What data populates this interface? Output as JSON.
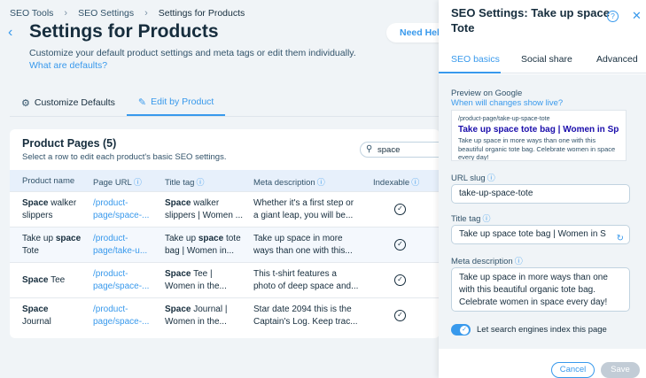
{
  "breadcrumb": [
    "SEO Tools",
    "SEO Settings",
    "Settings for Products"
  ],
  "page": {
    "title": "Settings for Products",
    "subtitle": "Customize your default product settings and meta tags or edit them individually.",
    "defaults_link": "What are defaults?",
    "help_button": "Need Help"
  },
  "tabs": [
    {
      "label": "Customize Defaults",
      "icon": "gear-icon"
    },
    {
      "label": "Edit by Product",
      "icon": "pencil-icon"
    }
  ],
  "table": {
    "title": "Product Pages (5)",
    "subtitle": "Select a row to edit each product's basic SEO settings.",
    "search_value": "space",
    "columns": [
      "Product name",
      "Page URL",
      "Title tag",
      "Meta description",
      "Indexable"
    ],
    "rows": [
      {
        "name": [
          {
            "b": "Space",
            "t": " walker"
          },
          {
            "t": "slippers"
          }
        ],
        "url": [
          "/product-",
          "page/space-..."
        ],
        "title_tag": [
          {
            "b": "Space",
            "t": " walker"
          },
          {
            "t": "slippers | Women ..."
          }
        ],
        "meta": [
          "Whether it's a first step or",
          "a giant leap, you will be..."
        ]
      },
      {
        "name": [
          {
            "t": "Take up ",
            "b": "space"
          },
          {
            "t": "Tote"
          }
        ],
        "url": [
          "/product-",
          "page/take-u..."
        ],
        "title_tag": [
          {
            "t": "Take up ",
            "b": "space",
            "t2": " tote"
          },
          {
            "t": "bag | Women in..."
          }
        ],
        "meta": [
          "Take up space in more",
          "ways than one with this..."
        ]
      },
      {
        "name": [
          {
            "b": "Space",
            "t": " Tee"
          }
        ],
        "url": [
          "/product-",
          "page/space-..."
        ],
        "title_tag": [
          {
            "b": "Space",
            "t": " Tee |"
          },
          {
            "t": "Women in the..."
          }
        ],
        "meta": [
          "This t-shirt features a",
          "photo of deep space and..."
        ]
      },
      {
        "name": [
          {
            "b": "Space"
          },
          {
            "t": "Journal"
          }
        ],
        "url": [
          "/product-",
          "page/space-..."
        ],
        "title_tag": [
          {
            "b": "Space",
            "t": " Journal |"
          },
          {
            "t": "Women in the..."
          }
        ],
        "meta": [
          "Star date 2094 this is the",
          "Captain's Log. Keep trac..."
        ]
      }
    ]
  },
  "panel": {
    "title": "SEO Settings: Take up space Tote",
    "tabs": [
      "SEO basics",
      "Social share",
      "Advanced"
    ],
    "preview_label": "Preview on Google",
    "preview_link": "When will changes show live?",
    "google_preview": {
      "url": "/product-page/take-up-space-tote",
      "title": "Take up space tote bag | Women in Sp...",
      "description": "Take up space in more ways than one with this beautiful organic tote bag. Celebrate women in space every day!"
    },
    "url_slug_label": "URL slug",
    "url_slug": "take-up-space-tote",
    "title_tag_label": "Title tag",
    "title_tag": "Take up space tote bag | Women in S",
    "meta_label": "Meta description",
    "meta_description": "Take up space in more ways than one with this beautiful organic tote bag. Celebrate women in space every day!",
    "index_label": "Let search engines index this page",
    "index_on": true,
    "cancel": "Cancel",
    "save": "Save"
  }
}
